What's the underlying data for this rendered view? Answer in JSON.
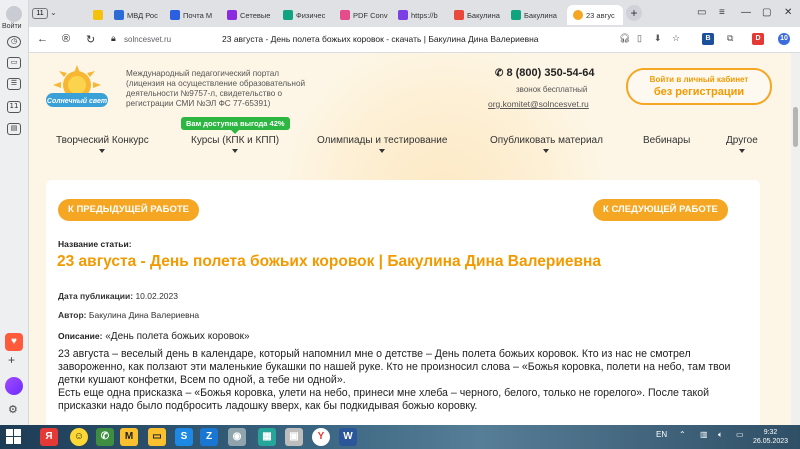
{
  "browser": {
    "profile_label": "Войти",
    "tab_count": "11",
    "tabs": [
      {
        "label": "",
        "color": "#1a73e8"
      },
      {
        "label": "МВД Рос",
        "color": "#2d6bd6"
      },
      {
        "label": "Почта М",
        "color": "#2b5fe0"
      },
      {
        "label": "Сетевые",
        "color": "#8a2be2"
      },
      {
        "label": "Физичес",
        "color": "#10a37f"
      },
      {
        "label": "PDF Conv",
        "color": "#e64c8b"
      },
      {
        "label": "https://b",
        "color": "#7b3fe4"
      },
      {
        "label": "Бакулина",
        "color": "#e9483a"
      },
      {
        "label": "Бакулина",
        "color": "#10a37f"
      },
      {
        "label": "23 авгус",
        "color": "#f5a623"
      }
    ],
    "url": "solncesvet.ru",
    "page_title": "23 августа - День полета божьих коровок - скачать | Бакулина Дина Валериевна",
    "ext_badge": "10"
  },
  "site": {
    "portal_text": "Международный педагогический портал (лицензия на осуществление образовательной деятельности №9757-л, свидетельство о регистрации СМИ №ЭЛ ФС 77-65391)",
    "phone": "8 (800) 350-54-64",
    "free_call": "звонок бесплатный",
    "email": "org.komitet@solncesvet.ru",
    "cabinet_line1": "Войти в личный кабинет",
    "cabinet_line2": "без регистрации",
    "promo": "Вам доступна выгода 42%",
    "logo_text": "Солнечный свет",
    "nav": [
      "Творческий Конкурс",
      "Курсы (КПК и КПП)",
      "Олимпиады и тестирование",
      "Опубликовать материал",
      "Вебинары",
      "Другое"
    ]
  },
  "article": {
    "prev_button": "К ПРЕДЫДУЩЕЙ РАБОТЕ",
    "next_button": "К СЛЕДУЮЩЕЙ РАБОТЕ",
    "name_label": "Название статьи:",
    "title": "23 августа - День полета божьих коровок | Бакулина Дина Валериевна",
    "date_label": "Дата публикации:",
    "date_value": "10.02.2023",
    "author_label": "Автор:",
    "author_value": "Бакулина Дина Валериевна",
    "desc_label": "Описание:",
    "desc_value": "«День полета божьих коровок»",
    "body_p1": "23 августа – веселый  день в календаре, который напомнил мне о детстве – День полета божьих коровок. Кто из нас не смотрел завороженно, как ползают эти маленькие букашки по нашей руке. Кто не произносил слова – «Божья коровка, полети на небо, там твои детки кушают конфетки, Всем по одной, а тебе ни одной».",
    "body_p2": "Есть еще одна присказка – «Божья коровка, улети на небо, принеси мне хлеба – черного, белого, только не горелого». После такой присказки надо было подбросить ладошку вверх, как бы подкидывая божью коровку."
  },
  "taskbar": {
    "lang": "EN",
    "time": "9:32",
    "date": "26.05.2023"
  },
  "colors": {
    "accent": "#f5a623",
    "title": "#f29a00",
    "promo": "#2db742"
  }
}
